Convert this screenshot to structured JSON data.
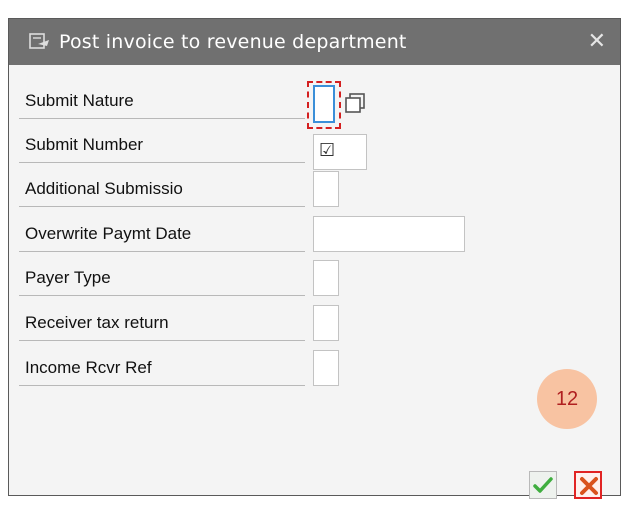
{
  "dialog": {
    "title": "Post invoice to revenue department",
    "close_glyph": "✕",
    "fields": [
      {
        "label": "Submit Nature",
        "value": ""
      },
      {
        "label": "Submit Number",
        "value": "☑"
      },
      {
        "label": "Additional Submissio",
        "value": ""
      },
      {
        "label": "Overwrite Paymt Date",
        "value": ""
      },
      {
        "label": "Payer Type",
        "value": ""
      },
      {
        "label": "Receiver tax return",
        "value": ""
      },
      {
        "label": "Income Rcvr Ref",
        "value": ""
      }
    ],
    "buttons": {
      "confirm_icon": "checkmark-icon",
      "cancel_icon": "cancel-x-icon"
    }
  },
  "badge": {
    "value": "12"
  },
  "colors": {
    "titlebar": "#707070",
    "dialog_bg": "#f4f4f4",
    "focus_border": "#d42020",
    "field_focus": "#3b8fd8",
    "badge_bg": "#f8c3a2",
    "badge_text": "#b02020"
  }
}
